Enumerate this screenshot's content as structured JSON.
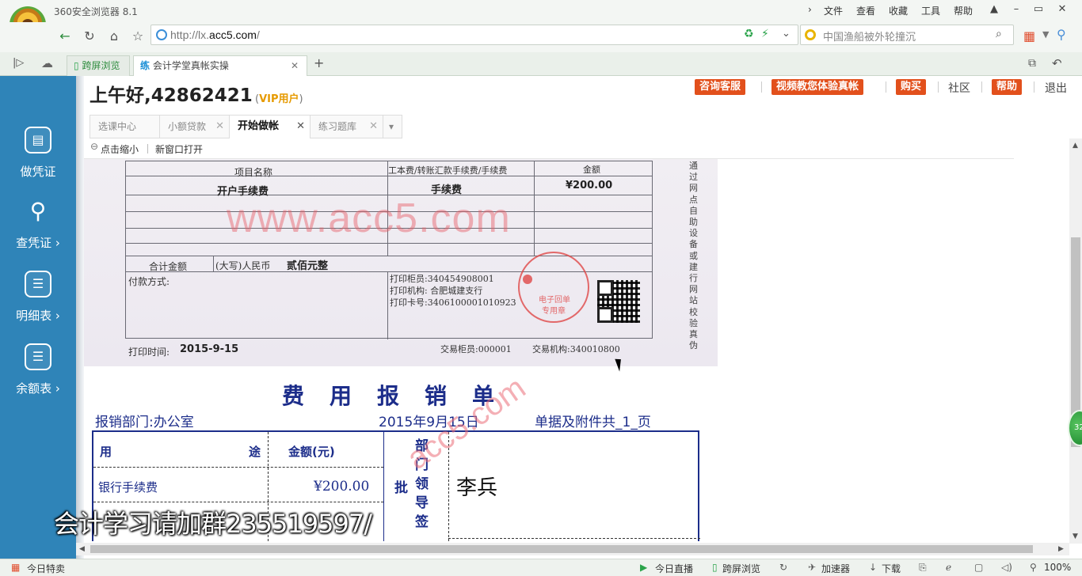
{
  "browser": {
    "title": "360安全浏览器 8.1",
    "menu": [
      "文件",
      "查看",
      "收藏",
      "工具",
      "帮助"
    ],
    "url_prefix": "http://lx.",
    "url_domain": "acc5.com",
    "url_suffix": "/",
    "search_placeholder": "中国渔船被外轮撞沉",
    "tabs": [
      {
        "label": "跨屏浏览"
      },
      {
        "icon_text": "练",
        "label": "会计学堂真帐实操"
      }
    ]
  },
  "sidebar": {
    "items": [
      {
        "label": "做凭证"
      },
      {
        "label": "查凭证 ›"
      },
      {
        "label": "明细表 ›"
      },
      {
        "label": "余额表 ›"
      }
    ]
  },
  "header": {
    "greeting": "上午好,42862421",
    "vip_open": "(",
    "vip_label": "VIP用户",
    "vip_close": ")",
    "buttons": [
      "咨询客服",
      "视频教您体验真帐",
      "购买"
    ],
    "community": "社区",
    "help": "帮助",
    "logout": "退出"
  },
  "inner_tabs": [
    {
      "label": "选课中心"
    },
    {
      "label": "小额贷款"
    },
    {
      "label": "开始做帐"
    },
    {
      "label": "练习题库"
    }
  ],
  "toolbar": {
    "zoom": "点击缩小",
    "open_new": "新窗口打开"
  },
  "receipt": {
    "col_item": "项目名称",
    "col_type": "工本费/转账汇款手续费/手续费",
    "col_amount": "金额",
    "row_item": "开户手续费",
    "row_type": "手续费",
    "row_amount": "¥200.00",
    "total_label": "合计金额",
    "total_upper_label": "(大写)人民币",
    "total_upper": "贰佰元整",
    "pay_method": "付款方式:",
    "print_teller": "打印柜员:340454908001",
    "print_org": "打印机构: 合肥城建支行",
    "print_card": "打印卡号:3406100001010923",
    "print_time_label": "打印时间:",
    "print_time": "2015-9-15",
    "trade_teller": "交易柜员:000001",
    "trade_org": "交易机构:340010800",
    "side_note": "通过网点自助设备或建行网站校验真伪",
    "watermark": "www.acc5.com",
    "stamp_line1": "电子回单",
    "stamp_line2": "专用章"
  },
  "expense_form": {
    "title": "费用报销单",
    "department": "报销部门:办公室",
    "date": "2015年9月15日",
    "attachments": "单据及附件共_1_页",
    "col_use_left": "用",
    "col_use_right": "途",
    "col_amount": "金额(元)",
    "approve_label": "批",
    "dept_leader_label": "部门领导签",
    "row_use": "银行手续费",
    "row_amount": "¥200.00",
    "signer": "李兵",
    "watermark": "acc5.com"
  },
  "caption": "会计学习请加群235519597/",
  "float_badge": "32",
  "statusbar": {
    "left": "今日特卖",
    "items": [
      "今日直播",
      "跨屏浏览",
      "加速器",
      "下载"
    ],
    "zoom": "100%"
  }
}
